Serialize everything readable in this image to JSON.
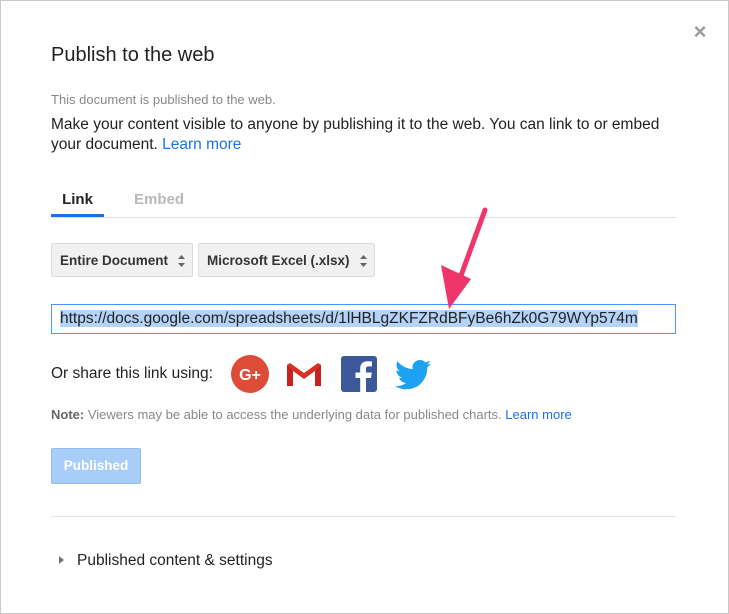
{
  "dialog": {
    "title": "Publish to the web",
    "close_glyph": "×",
    "status": "This document is published to the web.",
    "description": "Make your content visible to anyone by publishing it to the web. You can link to or embed your document.",
    "learn_more": "Learn more"
  },
  "tabs": [
    {
      "label": "Link",
      "active": true
    },
    {
      "label": "Embed",
      "active": false
    }
  ],
  "selects": {
    "scope": "Entire Document",
    "format": "Microsoft Excel (.xlsx)"
  },
  "url": {
    "value": "https://docs.google.com/spreadsheets/d/1lHBLgZKFZRdBFyBe6hZk0G79WYp574m"
  },
  "share": {
    "label": "Or share this link using:",
    "icons": [
      "google-plus-icon",
      "gmail-icon",
      "facebook-icon",
      "twitter-icon"
    ]
  },
  "note": {
    "prefix": "Note:",
    "text": " Viewers may be able to access the underlying data for published charts. ",
    "learn_more": "Learn more"
  },
  "publish_button": "Published",
  "settings_toggle": "Published content & settings",
  "colors": {
    "accent": "#1a73e8",
    "annotation_arrow": "#f0356b",
    "google_plus": "#dd4b39",
    "facebook": "#3b5998",
    "twitter": "#1da1f2"
  }
}
